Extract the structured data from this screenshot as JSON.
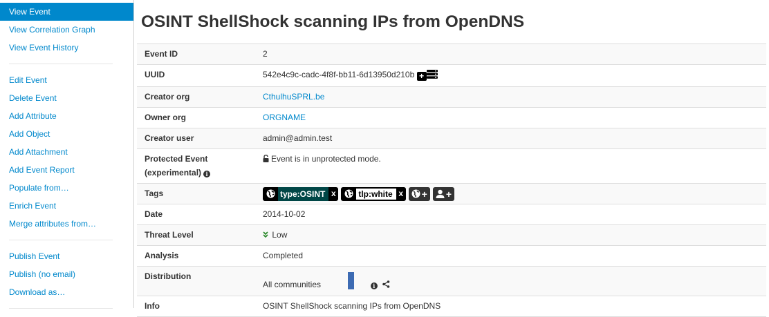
{
  "sidebar": {
    "groups": [
      [
        "View Event",
        "View Correlation Graph",
        "View Event History"
      ],
      [
        "Edit Event",
        "Delete Event",
        "Add Attribute",
        "Add Object",
        "Add Attachment",
        "Add Event Report",
        "Populate from…",
        "Enrich Event",
        "Merge attributes from…"
      ],
      [
        "Publish Event",
        "Publish (no email)",
        "Download as…"
      ]
    ],
    "active": "View Event"
  },
  "title": "OSINT ShellShock scanning IPs from OpenDNS",
  "fields": {
    "event_id": {
      "label": "Event ID",
      "value": "2"
    },
    "uuid": {
      "label": "UUID",
      "value": "542e4c9c-cadc-4f8f-bb11-6d13950d210b"
    },
    "creator_org": {
      "label": "Creator org",
      "value": "CthulhuSPRL.be"
    },
    "owner_org": {
      "label": "Owner org",
      "value": "ORGNAME"
    },
    "creator_user": {
      "label": "Creator user",
      "value": "admin@admin.test"
    },
    "protected": {
      "label_line1": "Protected Event",
      "label_line2": "(experimental)",
      "value": "Event is in unprotected mode."
    },
    "tags": {
      "label": "Tags",
      "items": [
        "type:OSINT",
        "tlp:white"
      ],
      "remove": "x"
    },
    "date": {
      "label": "Date",
      "value": "2014-10-02"
    },
    "threat_level": {
      "label": "Threat Level",
      "value": "Low"
    },
    "analysis": {
      "label": "Analysis",
      "value": "Completed"
    },
    "distribution": {
      "label": "Distribution",
      "value": "All communities"
    },
    "info": {
      "label": "Info",
      "value": "OSINT ShellShock scanning IPs from OpenDNS"
    }
  },
  "colors": {
    "accent": "#0088cc",
    "tag_osint": "#004646",
    "threat_low": "#2e8b2e",
    "dist_bar": "#3d6bb3"
  },
  "icons": [
    "plus-square-icon",
    "server-icon",
    "info-icon",
    "unlock-icon",
    "globe-icon",
    "user-plus-icon",
    "chevron-double-down-icon",
    "share-icon"
  ]
}
